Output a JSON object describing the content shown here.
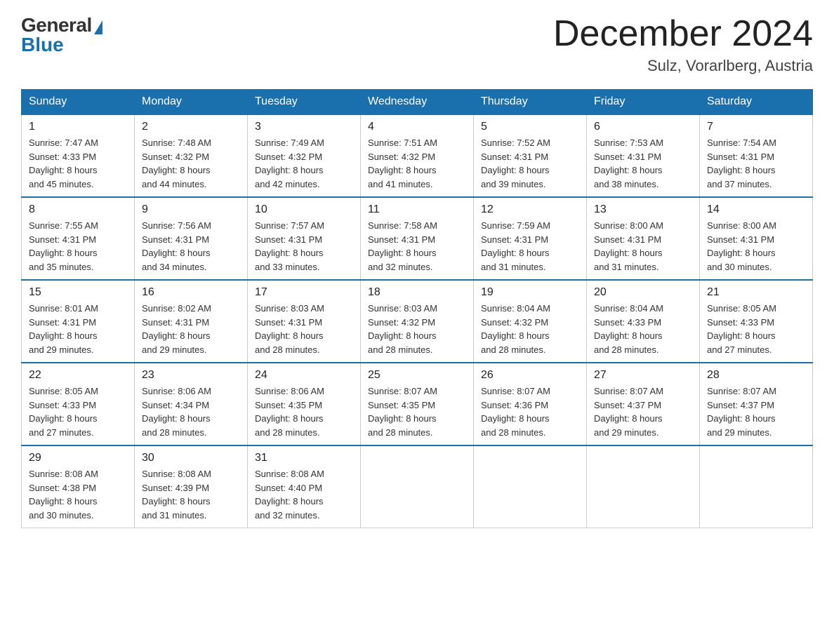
{
  "header": {
    "logo_general": "General",
    "logo_blue": "Blue",
    "month_title": "December 2024",
    "location": "Sulz, Vorarlberg, Austria"
  },
  "days_of_week": [
    "Sunday",
    "Monday",
    "Tuesday",
    "Wednesday",
    "Thursday",
    "Friday",
    "Saturday"
  ],
  "weeks": [
    [
      {
        "num": "1",
        "info": "Sunrise: 7:47 AM\nSunset: 4:33 PM\nDaylight: 8 hours\nand 45 minutes."
      },
      {
        "num": "2",
        "info": "Sunrise: 7:48 AM\nSunset: 4:32 PM\nDaylight: 8 hours\nand 44 minutes."
      },
      {
        "num": "3",
        "info": "Sunrise: 7:49 AM\nSunset: 4:32 PM\nDaylight: 8 hours\nand 42 minutes."
      },
      {
        "num": "4",
        "info": "Sunrise: 7:51 AM\nSunset: 4:32 PM\nDaylight: 8 hours\nand 41 minutes."
      },
      {
        "num": "5",
        "info": "Sunrise: 7:52 AM\nSunset: 4:31 PM\nDaylight: 8 hours\nand 39 minutes."
      },
      {
        "num": "6",
        "info": "Sunrise: 7:53 AM\nSunset: 4:31 PM\nDaylight: 8 hours\nand 38 minutes."
      },
      {
        "num": "7",
        "info": "Sunrise: 7:54 AM\nSunset: 4:31 PM\nDaylight: 8 hours\nand 37 minutes."
      }
    ],
    [
      {
        "num": "8",
        "info": "Sunrise: 7:55 AM\nSunset: 4:31 PM\nDaylight: 8 hours\nand 35 minutes."
      },
      {
        "num": "9",
        "info": "Sunrise: 7:56 AM\nSunset: 4:31 PM\nDaylight: 8 hours\nand 34 minutes."
      },
      {
        "num": "10",
        "info": "Sunrise: 7:57 AM\nSunset: 4:31 PM\nDaylight: 8 hours\nand 33 minutes."
      },
      {
        "num": "11",
        "info": "Sunrise: 7:58 AM\nSunset: 4:31 PM\nDaylight: 8 hours\nand 32 minutes."
      },
      {
        "num": "12",
        "info": "Sunrise: 7:59 AM\nSunset: 4:31 PM\nDaylight: 8 hours\nand 31 minutes."
      },
      {
        "num": "13",
        "info": "Sunrise: 8:00 AM\nSunset: 4:31 PM\nDaylight: 8 hours\nand 31 minutes."
      },
      {
        "num": "14",
        "info": "Sunrise: 8:00 AM\nSunset: 4:31 PM\nDaylight: 8 hours\nand 30 minutes."
      }
    ],
    [
      {
        "num": "15",
        "info": "Sunrise: 8:01 AM\nSunset: 4:31 PM\nDaylight: 8 hours\nand 29 minutes."
      },
      {
        "num": "16",
        "info": "Sunrise: 8:02 AM\nSunset: 4:31 PM\nDaylight: 8 hours\nand 29 minutes."
      },
      {
        "num": "17",
        "info": "Sunrise: 8:03 AM\nSunset: 4:31 PM\nDaylight: 8 hours\nand 28 minutes."
      },
      {
        "num": "18",
        "info": "Sunrise: 8:03 AM\nSunset: 4:32 PM\nDaylight: 8 hours\nand 28 minutes."
      },
      {
        "num": "19",
        "info": "Sunrise: 8:04 AM\nSunset: 4:32 PM\nDaylight: 8 hours\nand 28 minutes."
      },
      {
        "num": "20",
        "info": "Sunrise: 8:04 AM\nSunset: 4:33 PM\nDaylight: 8 hours\nand 28 minutes."
      },
      {
        "num": "21",
        "info": "Sunrise: 8:05 AM\nSunset: 4:33 PM\nDaylight: 8 hours\nand 27 minutes."
      }
    ],
    [
      {
        "num": "22",
        "info": "Sunrise: 8:05 AM\nSunset: 4:33 PM\nDaylight: 8 hours\nand 27 minutes."
      },
      {
        "num": "23",
        "info": "Sunrise: 8:06 AM\nSunset: 4:34 PM\nDaylight: 8 hours\nand 28 minutes."
      },
      {
        "num": "24",
        "info": "Sunrise: 8:06 AM\nSunset: 4:35 PM\nDaylight: 8 hours\nand 28 minutes."
      },
      {
        "num": "25",
        "info": "Sunrise: 8:07 AM\nSunset: 4:35 PM\nDaylight: 8 hours\nand 28 minutes."
      },
      {
        "num": "26",
        "info": "Sunrise: 8:07 AM\nSunset: 4:36 PM\nDaylight: 8 hours\nand 28 minutes."
      },
      {
        "num": "27",
        "info": "Sunrise: 8:07 AM\nSunset: 4:37 PM\nDaylight: 8 hours\nand 29 minutes."
      },
      {
        "num": "28",
        "info": "Sunrise: 8:07 AM\nSunset: 4:37 PM\nDaylight: 8 hours\nand 29 minutes."
      }
    ],
    [
      {
        "num": "29",
        "info": "Sunrise: 8:08 AM\nSunset: 4:38 PM\nDaylight: 8 hours\nand 30 minutes."
      },
      {
        "num": "30",
        "info": "Sunrise: 8:08 AM\nSunset: 4:39 PM\nDaylight: 8 hours\nand 31 minutes."
      },
      {
        "num": "31",
        "info": "Sunrise: 8:08 AM\nSunset: 4:40 PM\nDaylight: 8 hours\nand 32 minutes."
      },
      null,
      null,
      null,
      null
    ]
  ]
}
